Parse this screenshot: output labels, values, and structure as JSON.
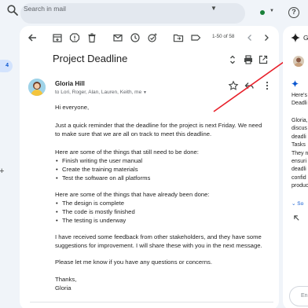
{
  "search": {
    "placeholder": "Search in mail"
  },
  "sidebar": {
    "inbox_count": "4"
  },
  "toolbar": {
    "pager": "1-50 of 58"
  },
  "email": {
    "subject": "Project Deadline",
    "sender": "Gloria Hill",
    "recipients": "to Lori, Roger, Alan, Lauren, Keith, me",
    "greeting": "Hi everyone,",
    "para1_l1": "Just a quick reminder that the deadline for the project is next Friday. We need",
    "para1_l2": "to make sure that we are all on track to meet this deadline.",
    "todo_intro": "Here are some of the things that still need to be done:",
    "todo": [
      "Finish writing the user manual",
      "Create the training materials",
      "Test the software on all platforms"
    ],
    "done_intro": "Here are some of the things that have already been done:",
    "done": [
      "The design is complete",
      "The code is mostly finished",
      "The testing is underway"
    ],
    "para3_l1": "I have received some feedback from other stakeholders, and they have some",
    "para3_l2": "suggestions for improvement. I will share these with you in the next message.",
    "para4": "Please let me know if you have any questions or concerns.",
    "signoff": "Thanks,",
    "signature": "Gloria"
  },
  "side_panel": {
    "header_partial": "G",
    "lines_a": [
      "Here's",
      "Deadli"
    ],
    "lines_b": [
      "Gloria,",
      "discus",
      "deadli",
      "Tasks",
      "They n",
      "ensuri",
      "deadli",
      "confid",
      "produc"
    ],
    "sources_partial": "So",
    "input_placeholder": "En"
  },
  "colors": {
    "accent": "#0b57d0",
    "arrow": "#e8202a",
    "star": "#0b57d0"
  }
}
